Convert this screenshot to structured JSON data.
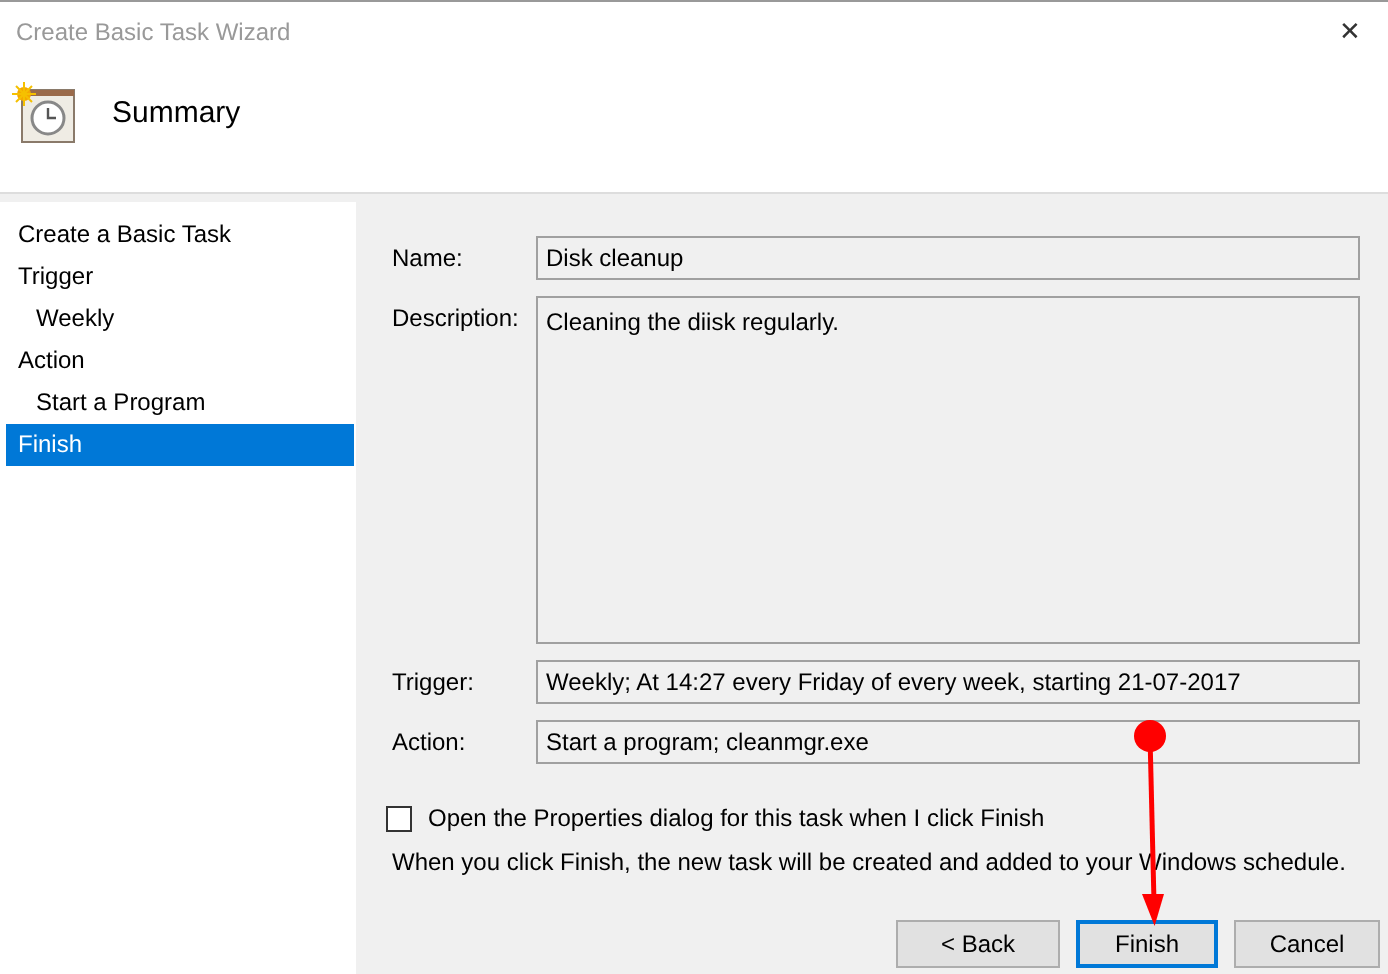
{
  "window": {
    "title": "Create Basic Task Wizard",
    "close": "✕"
  },
  "header": {
    "title": "Summary"
  },
  "sidebar": {
    "items": [
      {
        "label": "Create a Basic Task",
        "selected": false
      },
      {
        "label": "Trigger",
        "selected": false,
        "children": [
          {
            "label": "Weekly",
            "selected": false
          }
        ]
      },
      {
        "label": "Action",
        "selected": false,
        "children": [
          {
            "label": "Start a Program",
            "selected": false
          }
        ]
      },
      {
        "label": "Finish",
        "selected": true
      }
    ]
  },
  "fields": [
    {
      "label": "Name:",
      "value": "Disk cleanup",
      "kind": "line"
    },
    {
      "label": "Description:",
      "value": "Cleaning the diisk regularly.",
      "kind": "area"
    },
    {
      "label": "Trigger:",
      "value": "Weekly; At 14:27 every Friday of every week, starting 21-07-2017",
      "kind": "line"
    },
    {
      "label": "Action:",
      "value": "Start a program; cleanmgr.exe",
      "kind": "line"
    }
  ],
  "checkbox": {
    "label": "Open the Properties dialog for this task when I click Finish",
    "checked": false
  },
  "note": "When you click Finish, the new task will be created and added to your Windows schedule.",
  "buttons": [
    {
      "label": "< Back",
      "selected": false
    },
    {
      "label": "Finish",
      "selected": true
    },
    {
      "label": "Cancel",
      "selected": false
    }
  ]
}
